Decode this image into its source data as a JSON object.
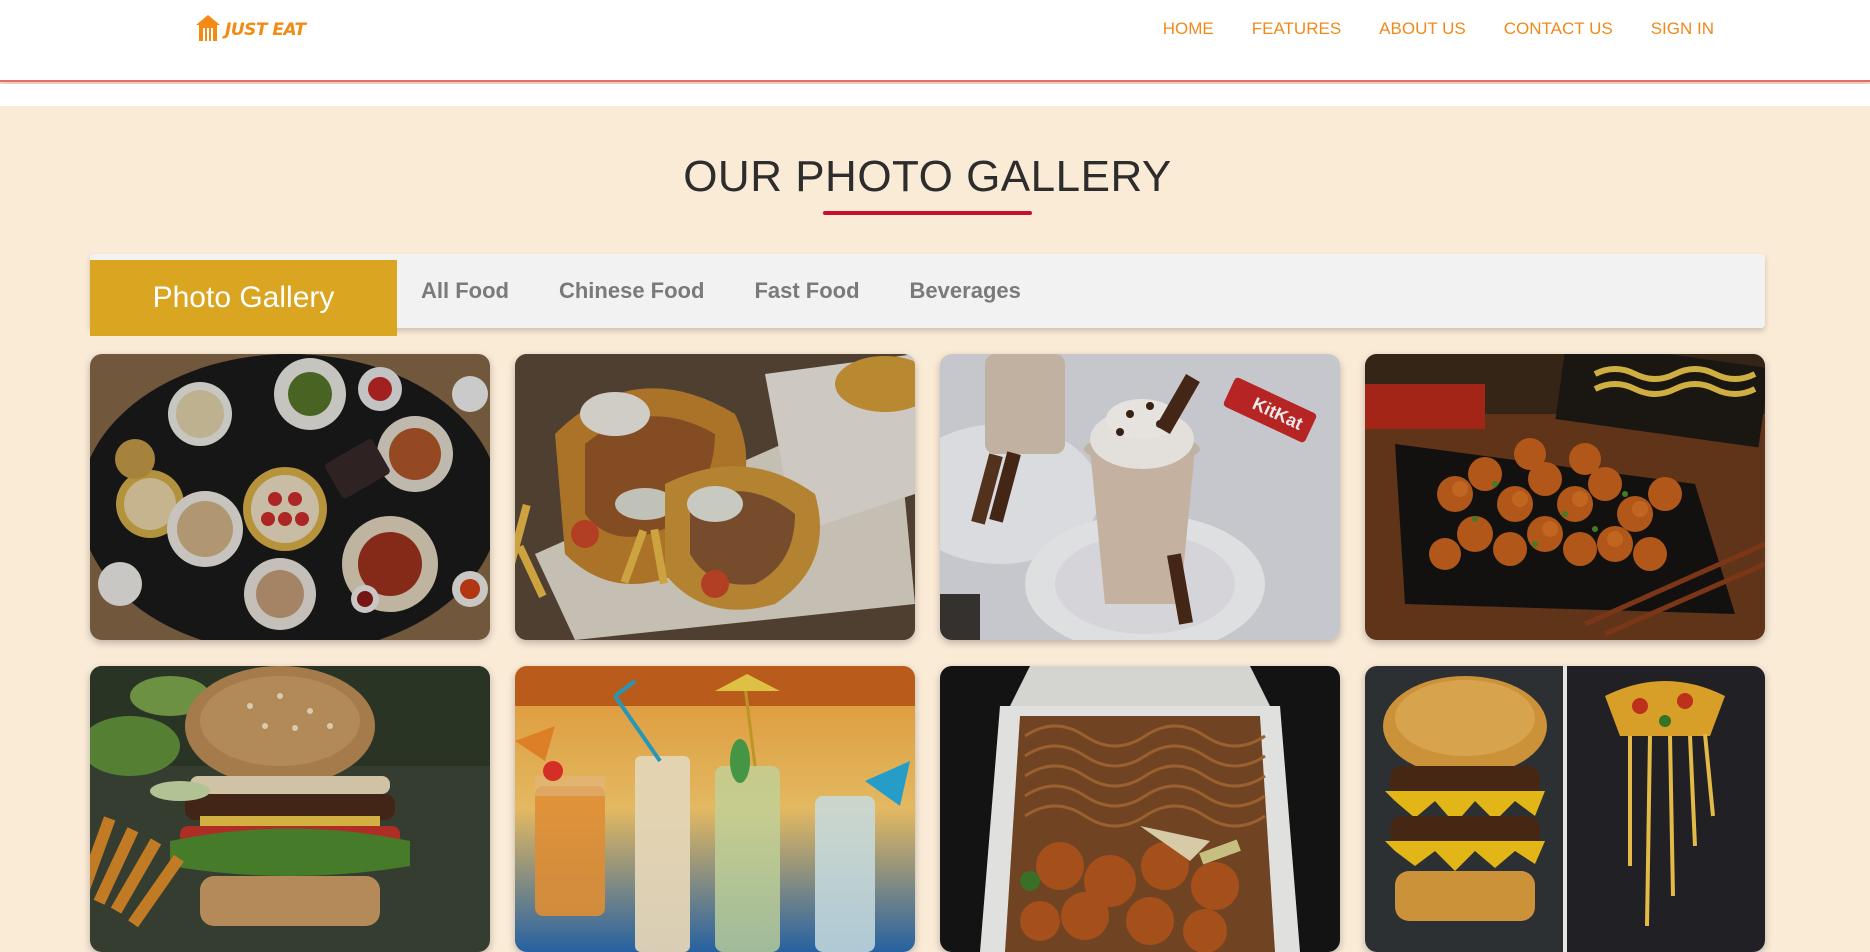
{
  "header": {
    "logo_text": "JUST EAT",
    "logo_icon": "house-fork-icon",
    "nav": [
      "HOME",
      "FEATURES",
      "ABOUT US",
      "CONTACT US",
      "SIGN IN"
    ]
  },
  "gallery": {
    "title": "OUR PHOTO GALLERY",
    "heading": "Photo Gallery",
    "tabs": [
      "All Food",
      "Chinese Food",
      "Fast Food",
      "Beverages"
    ],
    "photos": [
      "dim-sum-feast",
      "gyro-wrap-with-fries",
      "chocolate-milkshake",
      "sweet-and-sour-chicken",
      "burger-with-fries",
      "tropical-cocktails",
      "noodles-takeout-box",
      "burger-and-pizza"
    ]
  },
  "colors": {
    "brand_orange": "#f38a13",
    "background": "#faebd7",
    "accent_red": "#c8102e",
    "tab_gold": "#daa520"
  }
}
